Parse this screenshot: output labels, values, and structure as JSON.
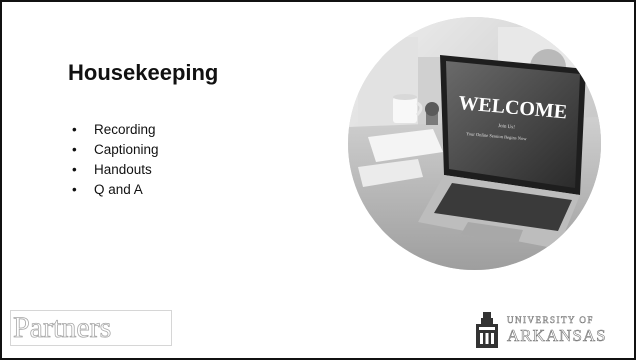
{
  "slide": {
    "title": "Housekeeping",
    "bullets": [
      "Recording",
      "Captioning",
      "Handouts",
      "Q and A"
    ],
    "bullet_glyph": "•"
  },
  "photo": {
    "screen_heading": "WELCOME",
    "screen_line1": "Join Us!",
    "screen_line2": "Your Online Session Begins Now"
  },
  "footer": {
    "partners_logo": "Partners",
    "university_line1": "UNIVERSITY OF",
    "university_line2": "ARKANSAS"
  }
}
